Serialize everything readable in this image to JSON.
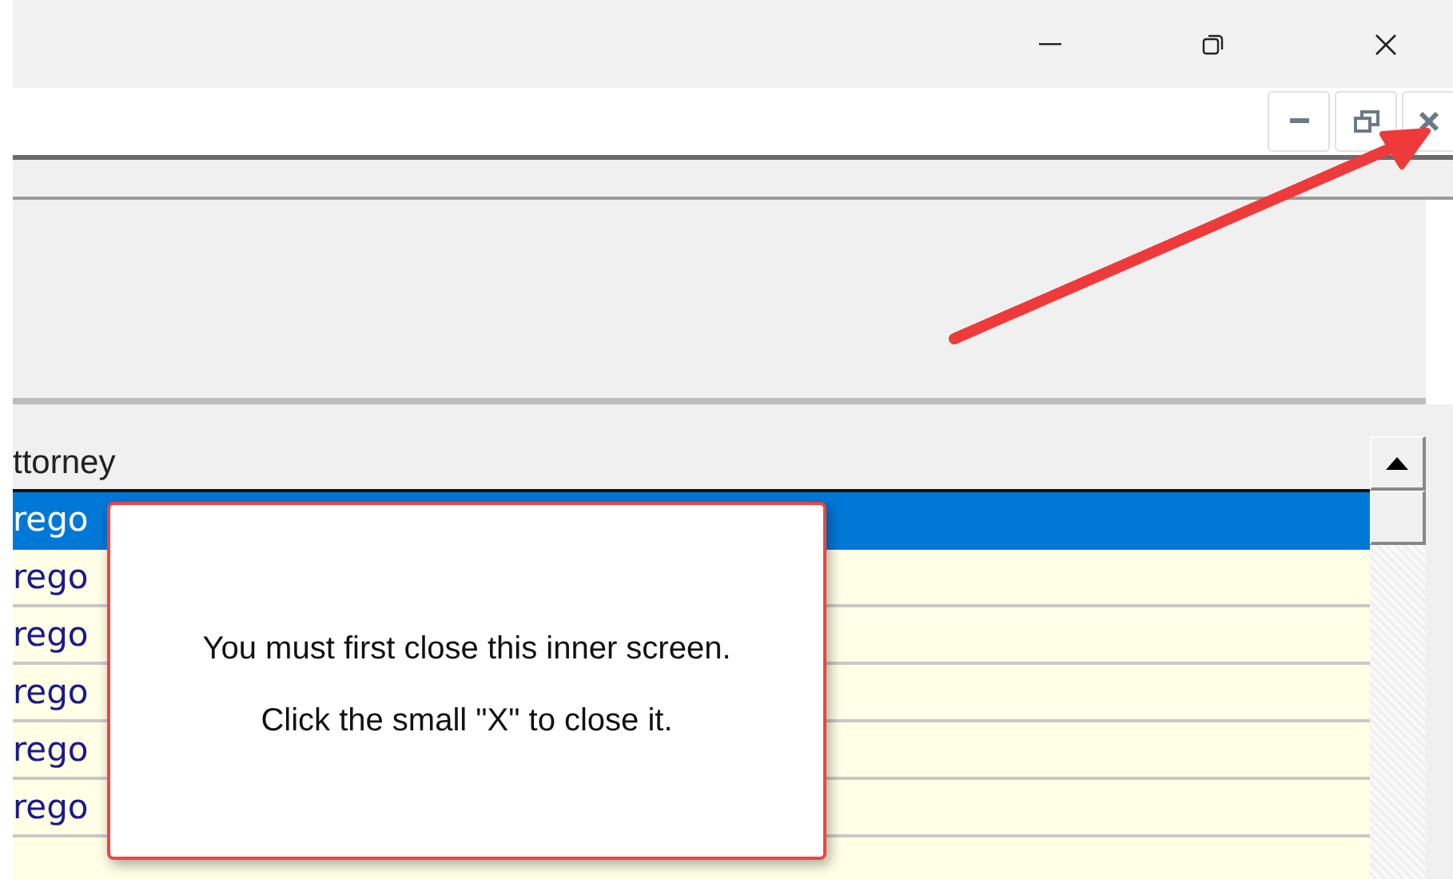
{
  "table": {
    "columns": [
      "ttorney"
    ],
    "rows": [
      {
        "cells": [
          "rego"
        ],
        "selected": true
      },
      {
        "cells": [
          "rego"
        ],
        "selected": false
      },
      {
        "cells": [
          "rego"
        ],
        "selected": false
      },
      {
        "cells": [
          "rego"
        ],
        "selected": false
      },
      {
        "cells": [
          "rego"
        ],
        "selected": false
      },
      {
        "cells": [
          "rego"
        ],
        "selected": false
      }
    ]
  },
  "popup": {
    "messages": [
      "You must first close this inner screen.",
      "Click the small \"X\" to close it."
    ]
  }
}
